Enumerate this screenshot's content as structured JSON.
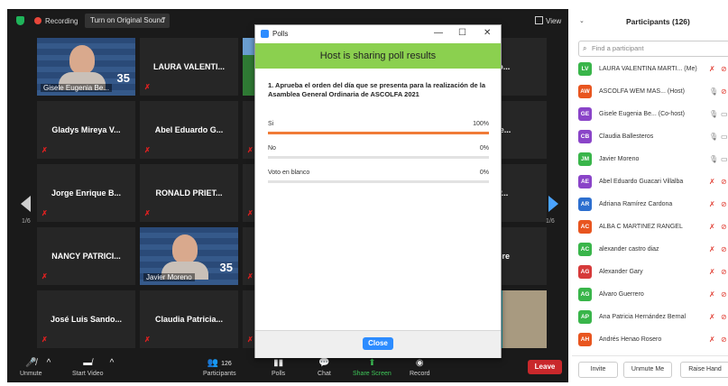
{
  "topbar": {
    "recording_label": "Recording",
    "original_sound_label": "Turn on Original Sound",
    "view_label": "View"
  },
  "grid": {
    "page_left": "1/6",
    "page_right": "1/6",
    "tiles": [
      {
        "name": "Gisele Eugenia Be...",
        "kind": "video",
        "badge": "35",
        "active": true
      },
      {
        "name": "LAURA VALENTI...",
        "kind": "name"
      },
      {
        "name": "",
        "kind": "nature"
      },
      {
        "name": "Soto...",
        "kind": "name"
      },
      {
        "name": "Gladys Mireya V...",
        "kind": "name"
      },
      {
        "name": "Abel Eduardo G...",
        "kind": "name"
      },
      {
        "name": "",
        "kind": "name"
      },
      {
        "name": "rigue...",
        "kind": "name"
      },
      {
        "name": "Jorge Enrique B...",
        "kind": "name"
      },
      {
        "name": "RONALD PRIET...",
        "kind": "name"
      },
      {
        "name": "",
        "kind": "name"
      },
      {
        "name": "ÍA P...",
        "kind": "name"
      },
      {
        "name": "NANCY PATRICI...",
        "kind": "name"
      },
      {
        "name": "Javier Moreno",
        "kind": "video",
        "badge": "35"
      },
      {
        "name": "",
        "kind": "name"
      },
      {
        "name": "l Libre",
        "kind": "name"
      },
      {
        "name": "José Luis Sando...",
        "kind": "name"
      },
      {
        "name": "Claudia Patricia...",
        "kind": "name"
      },
      {
        "name": "",
        "kind": "name"
      },
      {
        "name": "",
        "kind": "room"
      }
    ]
  },
  "poll": {
    "window_title": "Polls",
    "banner": "Host is sharing poll results",
    "question": "1. Aprueba el orden del día que se presenta para la realización de la Asamblea General Ordinaria de ASCOLFA 2021",
    "options": [
      {
        "label": "Si",
        "percent_label": "100%",
        "percent": 100
      },
      {
        "label": "No",
        "percent_label": "0%",
        "percent": 0
      },
      {
        "label": "Voto en blanco",
        "percent_label": "0%",
        "percent": 0
      }
    ],
    "close_label": "Close"
  },
  "toolbar": {
    "unmute": "Unmute",
    "start_video": "Start Video",
    "participants": "Participants",
    "participants_count": "126",
    "polls": "Polls",
    "chat": "Chat",
    "share_screen": "Share Screen",
    "record": "Record",
    "leave": "Leave"
  },
  "panel": {
    "title": "Participants (126)",
    "search_placeholder": "Find a participant",
    "participants": [
      {
        "initials": "LV",
        "color": "#39b54a",
        "name": "LAURA VALENTINA MARTI...",
        "tag": "(Me)",
        "mic_on": false,
        "video_on": false
      },
      {
        "initials": "AW",
        "color": "#e8551f",
        "name": "ASCOLFA WEM MAS...",
        "tag": "(Host)",
        "mic_on": true,
        "video_on": false
      },
      {
        "initials": "GE",
        "color": "#8a44c8",
        "name": "Gisele Eugenia Be...",
        "tag": "(Co-host)",
        "mic_on": true,
        "video_on": true
      },
      {
        "initials": "CB",
        "color": "#8a44c8",
        "name": "Claudia Ballesteros",
        "tag": "",
        "mic_on": true,
        "video_on": true
      },
      {
        "initials": "JM",
        "color": "#39b54a",
        "name": "Javier Moreno",
        "tag": "",
        "mic_on": true,
        "video_on": true
      },
      {
        "initials": "AE",
        "color": "#8a44c8",
        "name": "Abel Eduardo Guacari Villalba",
        "tag": "",
        "mic_on": false,
        "video_on": false
      },
      {
        "initials": "AR",
        "color": "#2d6fcf",
        "name": "Adriana Ramírez Cardona",
        "tag": "",
        "mic_on": false,
        "video_on": false
      },
      {
        "initials": "AC",
        "color": "#e8551f",
        "name": "ALBA C MARTINEZ RANGEL",
        "tag": "",
        "mic_on": false,
        "video_on": false
      },
      {
        "initials": "AC",
        "color": "#39b54a",
        "name": "alexander castro diaz",
        "tag": "",
        "mic_on": false,
        "video_on": false
      },
      {
        "initials": "AG",
        "color": "#d63a3a",
        "name": "Alexander Gary",
        "tag": "",
        "mic_on": false,
        "video_on": false
      },
      {
        "initials": "AG",
        "color": "#39b54a",
        "name": "Alvaro Guerrero",
        "tag": "",
        "mic_on": false,
        "video_on": false
      },
      {
        "initials": "AP",
        "color": "#39b54a",
        "name": "Ana Patricia Hernández Bernal",
        "tag": "",
        "mic_on": false,
        "video_on": false
      },
      {
        "initials": "AH",
        "color": "#e8551f",
        "name": "Andrés Henao Rosero",
        "tag": "",
        "mic_on": false,
        "video_on": false
      }
    ],
    "invite": "Invite",
    "unmute_me": "Unmute Me",
    "raise_hand": "Raise Hand"
  }
}
